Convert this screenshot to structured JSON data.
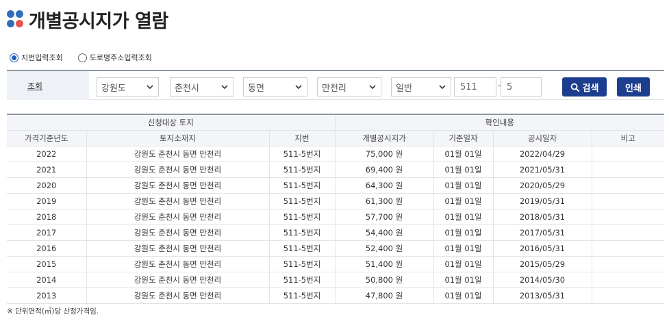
{
  "page": {
    "title": "개별공시지가 열람"
  },
  "radio_options": [
    {
      "label": "지번입력조회",
      "selected": true
    },
    {
      "label": "도로명주소입력조회",
      "selected": false
    }
  ],
  "search": {
    "label": "조회",
    "province": "강원도",
    "city": "춘천시",
    "town": "동면",
    "village": "만천리",
    "land_type": "일반",
    "main_no": "511",
    "dash": "-",
    "sub_no": "5",
    "search_button": "검색",
    "print_button": "인쇄"
  },
  "table": {
    "group_headers": {
      "target": "신청대상 토지",
      "confirm": "확인내용"
    },
    "columns": [
      "가격기준년도",
      "토지소재지",
      "지번",
      "개별공시지가",
      "기준일자",
      "공시일자",
      "비고"
    ],
    "rows": [
      [
        "2022",
        "강원도 춘천시 동면 만천리",
        "511-5번지",
        "75,000 원",
        "01월 01일",
        "2022/04/29",
        ""
      ],
      [
        "2021",
        "강원도 춘천시 동면 만천리",
        "511-5번지",
        "69,400 원",
        "01월 01일",
        "2021/05/31",
        ""
      ],
      [
        "2020",
        "강원도 춘천시 동면 만천리",
        "511-5번지",
        "64,300 원",
        "01월 01일",
        "2020/05/29",
        ""
      ],
      [
        "2019",
        "강원도 춘천시 동면 만천리",
        "511-5번지",
        "61,300 원",
        "01월 01일",
        "2019/05/31",
        ""
      ],
      [
        "2018",
        "강원도 춘천시 동면 만천리",
        "511-5번지",
        "57,700 원",
        "01월 01일",
        "2018/05/31",
        ""
      ],
      [
        "2017",
        "강원도 춘천시 동면 만천리",
        "511-5번지",
        "54,400 원",
        "01월 01일",
        "2017/05/31",
        ""
      ],
      [
        "2016",
        "강원도 춘천시 동면 만천리",
        "511-5번지",
        "52,400 원",
        "01월 01일",
        "2016/05/31",
        ""
      ],
      [
        "2015",
        "강원도 춘천시 동면 만천리",
        "511-5번지",
        "51,400 원",
        "01월 01일",
        "2015/05/29",
        ""
      ],
      [
        "2014",
        "강원도 춘천시 동면 만천리",
        "511-5번지",
        "50,800 원",
        "01월 01일",
        "2014/05/30",
        ""
      ],
      [
        "2013",
        "강원도 춘천시 동면 만천리",
        "511-5번지",
        "47,800 원",
        "01월 01일",
        "2013/05/31",
        ""
      ]
    ]
  },
  "footnote": "※ 단위면적(㎡)당 산정가격임.",
  "icons": {
    "title": "dots-logo-icon",
    "search": "search-icon",
    "dropdown": "chevron-down-icon"
  },
  "colors": {
    "accent": "#1d3d8f",
    "dot_blue": "#2f6fb7",
    "dot_red": "#e8534a"
  }
}
